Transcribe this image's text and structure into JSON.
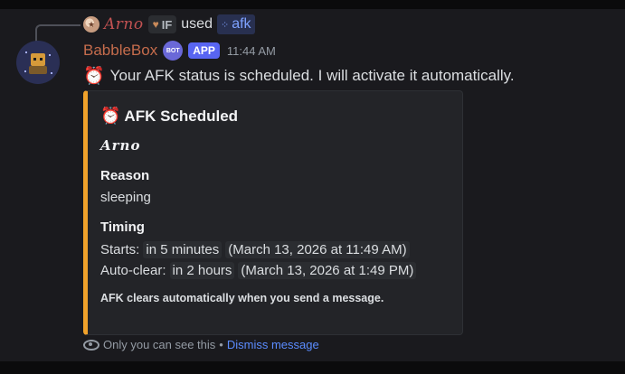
{
  "reply": {
    "user_name": "Arno",
    "tag": "IF",
    "used_text": "used",
    "command_name": "afk"
  },
  "message": {
    "bot_name": "BabbleBox",
    "bot_badge": "BOT",
    "app_badge": "APP",
    "timestamp": "11:44 AM",
    "content": "Your AFK status is scheduled. I will activate it automatically."
  },
  "embed": {
    "accent_color": "#f0a22b",
    "title": "AFK Scheduled",
    "user": "Arno",
    "reason_label": "Reason",
    "reason_value": "sleeping",
    "timing_label": "Timing",
    "starts_label": "Starts:",
    "starts_relative": "in 5 minutes",
    "starts_absolute": "March 13, 2026 at 11:49 AM",
    "autoclear_label": "Auto-clear:",
    "autoclear_relative": "in 2 hours",
    "autoclear_absolute": "March 13, 2026 at 1:49 PM",
    "footnote": "AFK clears automatically when you send a message."
  },
  "ephemeral": {
    "notice": "Only you can see this",
    "separator": "•",
    "dismiss_label": "Dismiss message"
  },
  "icons": {
    "clock": "alarm-clock-icon",
    "eye": "eye-icon",
    "command": "slash-command-icon"
  },
  "colors": {
    "bot_name": "#c56c4c",
    "reply_name": "#c25252",
    "link": "#5b8cff",
    "app_badge": "#5865f2"
  }
}
